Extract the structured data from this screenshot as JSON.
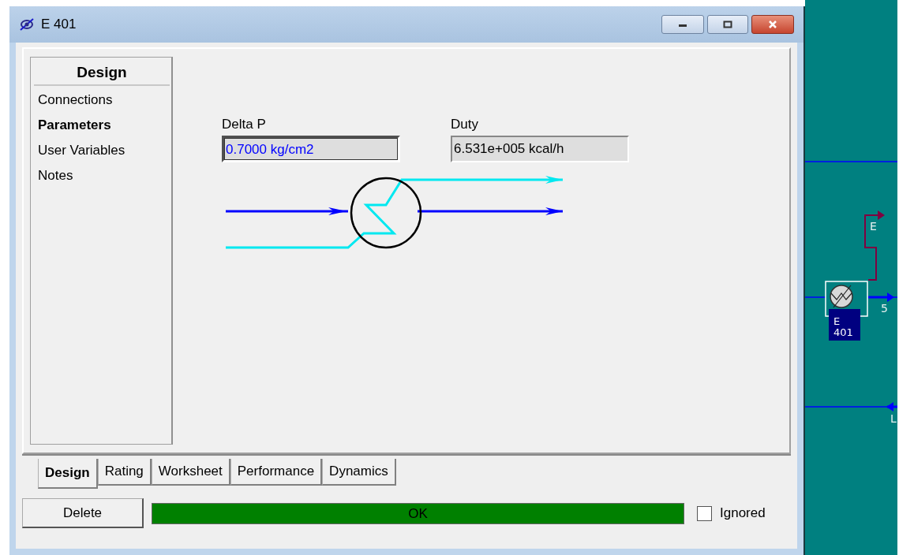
{
  "window": {
    "title": "E 401"
  },
  "sidebar": {
    "header": "Design",
    "items": [
      {
        "label": "Connections",
        "selected": false
      },
      {
        "label": "Parameters",
        "selected": true
      },
      {
        "label": "User Variables",
        "selected": false
      },
      {
        "label": "Notes",
        "selected": false
      }
    ]
  },
  "fields": [
    {
      "label": "Delta P",
      "value": "0.7000 kg/cm2",
      "kind": "specified"
    },
    {
      "label": "Duty",
      "value": "6.531e+005 kcal/h",
      "kind": "calculated"
    }
  ],
  "tabs": [
    {
      "label": "Design",
      "selected": true
    },
    {
      "label": "Rating",
      "selected": false
    },
    {
      "label": "Worksheet",
      "selected": false
    },
    {
      "label": "Performance",
      "selected": false
    },
    {
      "label": "Dynamics",
      "selected": false
    }
  ],
  "delete_button": "Delete",
  "status": "OK",
  "ignored": {
    "label": "Ignored",
    "checked": false
  },
  "flowsheet": {
    "energy_stream": "E",
    "product_stream": "5",
    "unit_label": [
      "E",
      "401"
    ],
    "bottom_stream": "L"
  }
}
